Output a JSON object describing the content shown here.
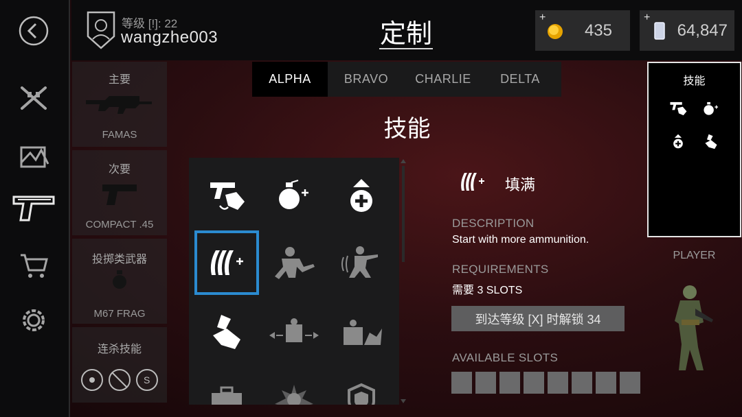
{
  "header": {
    "level_label": "等级 [!]: 22",
    "username": "wangzhe003",
    "title": "定制",
    "gold": {
      "plus": "+",
      "value": "435"
    },
    "cash": {
      "plus": "+",
      "value": "64,847"
    }
  },
  "loadout": {
    "primary": {
      "label": "主要",
      "item": "FAMAS"
    },
    "secondary": {
      "label": "次要",
      "item": "COMPACT .45"
    },
    "throwable": {
      "label": "投掷类武器",
      "item": "M67 FRAG"
    },
    "killstreak": {
      "label": "连杀技能"
    }
  },
  "tabs": [
    "ALPHA",
    "BRAVO",
    "CHARLIE",
    "DELTA"
  ],
  "active_tab": "ALPHA",
  "section_title": "技能",
  "grid_icons": [
    "fast-reload-icon",
    "extra-grenade-icon",
    "health-boost-icon",
    "extended-ammo-icon",
    "stealth-icon",
    "sprint-shoot-icon",
    "quick-swap-icon",
    "cover-move-icon",
    "cover-fire-icon",
    "ammo-crate-icon",
    "grenade-blast-icon",
    "armor-shield-icon"
  ],
  "selected_index": 3,
  "detail": {
    "name": "填满",
    "description_heading": "DESCRIPTION",
    "description": "Start with more ammunition.",
    "requirements_heading": "REQUIREMENTS",
    "requirements": "需要 3 SLOTS",
    "unlock_button": "到达等级 [X] 时解锁 34",
    "slots_heading": "AVAILABLE SLOTS",
    "slot_count": 8
  },
  "summary": {
    "title": "技能",
    "icons": [
      "fast-reload-icon",
      "extra-grenade-icon",
      "health-boost-icon",
      "quick-swap-icon"
    ]
  },
  "player_label": "PLAYER",
  "colors": {
    "selection": "#2b8bd0",
    "background": "#2a0d10"
  }
}
